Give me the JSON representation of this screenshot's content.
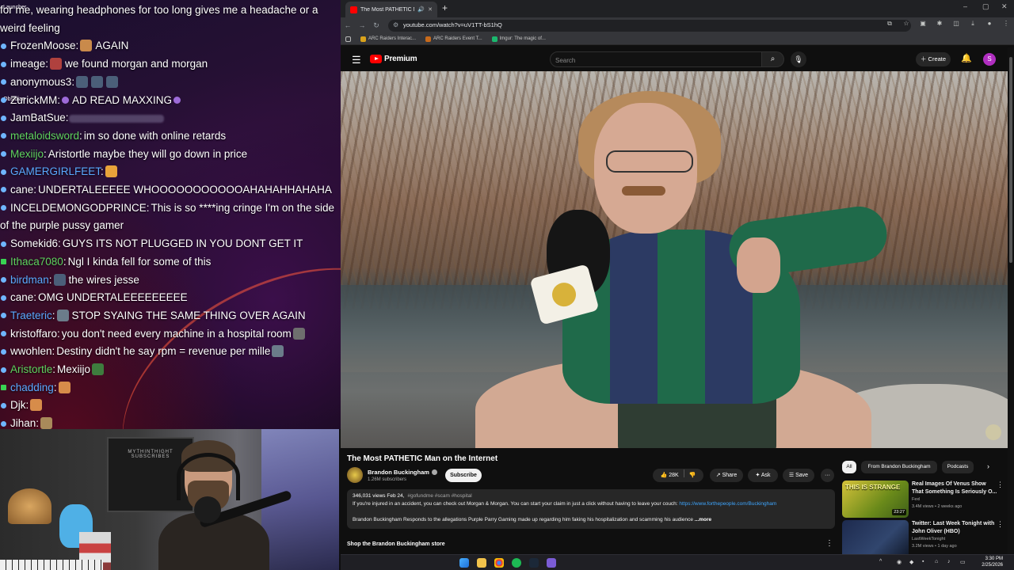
{
  "chat": {
    "messages": [
      {
        "user": "",
        "text": "for me, wearing headphones for too long gives me a headache or a weird feeling",
        "bullet": "none",
        "wrap": true
      },
      {
        "user": "FrozenMoose",
        "text": "AGAIN",
        "emotes_before": [
          "e1"
        ],
        "color": "white"
      },
      {
        "user": "imeage",
        "text": "we found morgan and morgan",
        "emotes_before": [
          "e2"
        ],
        "color": "white"
      },
      {
        "user": "anonymous3",
        "text": "",
        "emotes_before": [
          "e3",
          "e3",
          "e3"
        ],
        "color": "white"
      },
      {
        "user": "ZurickMM",
        "text": "AD READ MAXXING",
        "emotes_before": [
          "e4"
        ],
        "emotes_after": [
          "e4"
        ],
        "color": "white"
      },
      {
        "user": "JamBatSue",
        "text": "",
        "blurred": true,
        "color": "white"
      },
      {
        "user": "metaloidsword",
        "text": "im so done with online retards",
        "color": "green"
      },
      {
        "user": "Mexiijo",
        "text": "Aristortle maybe they will go down in price",
        "color": "green"
      },
      {
        "user": "GAMERGIRLFEET",
        "text": "",
        "emotes_after": [
          "e5"
        ],
        "color": "blue"
      },
      {
        "user": "cane",
        "text": "UNDERTALEEEEE WHOOOOOOOOOOOAHAHAHHAHAHA",
        "color": "white"
      },
      {
        "user": "INCELDEMONGODPRINCE",
        "text": "This is so ****ing cringe I'm on the side of the purple pussy gamer",
        "color": "white",
        "wrap": true
      },
      {
        "user": "Somekid6",
        "text": "GUYS ITS NOT PLUGGED IN YOU DONT GET IT",
        "color": "white"
      },
      {
        "user": "Ithaca7080",
        "text": "Ngl I kinda fell for some of this",
        "color": "green",
        "bullet": "green"
      },
      {
        "user": "birdman",
        "text": "the wires jesse",
        "emotes_before": [
          "e3"
        ],
        "color": "blue"
      },
      {
        "user": "cane",
        "text": "OMG UNDERTALEEEEEEEEE",
        "color": "white"
      },
      {
        "user": "Traeteric",
        "text": "STOP SYAING THE SAME THING OVER AGAIN",
        "emotes_before": [
          "e6"
        ],
        "color": "blue"
      },
      {
        "user": "kristoffaro",
        "text": "you don't need every machine in a hospital room",
        "emotes_after": [
          "e8"
        ],
        "color": "white"
      },
      {
        "user": "wwohlen",
        "text": "Destiny didn't he say rpm = revenue per mille",
        "emotes_after": [
          "e6"
        ],
        "color": "white"
      },
      {
        "user": "Aristortle",
        "text": "Mexiijo",
        "emotes_after": [
          "e10"
        ],
        "color": "green"
      },
      {
        "user": "chadding",
        "text": "",
        "emotes_before": [
          "e7"
        ],
        "color": "blue",
        "bullet": "green"
      },
      {
        "user": "Djk",
        "text": "",
        "emotes_before": [
          "e7"
        ],
        "color": "white"
      },
      {
        "user": "Jihan",
        "text": "",
        "emotes_before": [
          "e9"
        ],
        "color": "white"
      }
    ],
    "desktop_icons": [
      "Launcher",
      "Obsidian"
    ]
  },
  "webcam": {
    "poster_text": "MYTHINTHIGHT SUBSCRIBES"
  },
  "browser": {
    "tab": {
      "title": "The Most PATHETIC Man on th",
      "audio_icon": "speaker-icon",
      "close": "✕"
    },
    "new_tab": "+",
    "window_controls": [
      "–",
      "▢",
      "✕"
    ],
    "url": "youtube.com/watch?v=uV1TT-bS1hQ",
    "bookmarks": [
      "ARC Raiders Interac...",
      "ARC Raiders Event T...",
      "Imgur: The magic of..."
    ]
  },
  "youtube": {
    "logo_text": "Premium",
    "search_placeholder": "Search",
    "create_label": "Create",
    "avatar_letter": "S",
    "video": {
      "title": "The Most PATHETIC Man on the Internet",
      "channel": "Brandon Buckingham",
      "subscribers": "1.26M subscribers",
      "subscribe_label": "Subscribe",
      "likes": "28K",
      "share_label": "Share",
      "ask_label": "Ask",
      "save_label": "Save",
      "views_date": "346,031 views  Feb 24,",
      "tags": "#gofundme #scam #hospital",
      "description_1": "If you're injured in an accident, you can check out Morgan & Morgan. You can start your claim in just a click without having to leave your couch:",
      "description_link": "https://www.forthepeople.com/Buckingham",
      "description_2": "Brandon Buckingham Responds to the allegations Purple Parry Gaming made up regarding him faking his hospitalization and scamming his audience",
      "more_label": "...more",
      "store_label": "Shop the Brandon Buckingham store"
    },
    "chips": [
      "All",
      "From Brandon Buckingham",
      "Podcasts"
    ],
    "recommendations": [
      {
        "title": "Real Images Of Venus Show That Something Is Seriously O...",
        "channel": "Fexl",
        "stats": "3.4M views • 2 weeks ago",
        "duration": "23:27",
        "thumb_text": "THIS IS STRANGE"
      },
      {
        "title": "Twitter: Last Week Tonight with John Oliver (HBO)",
        "channel": "LastWeekTonight",
        "stats": "3.2M views • 1 day ago",
        "duration": "",
        "thumb_text": ""
      }
    ]
  },
  "taskbar": {
    "time": "3:30 PM",
    "date": "2/25/2026"
  }
}
